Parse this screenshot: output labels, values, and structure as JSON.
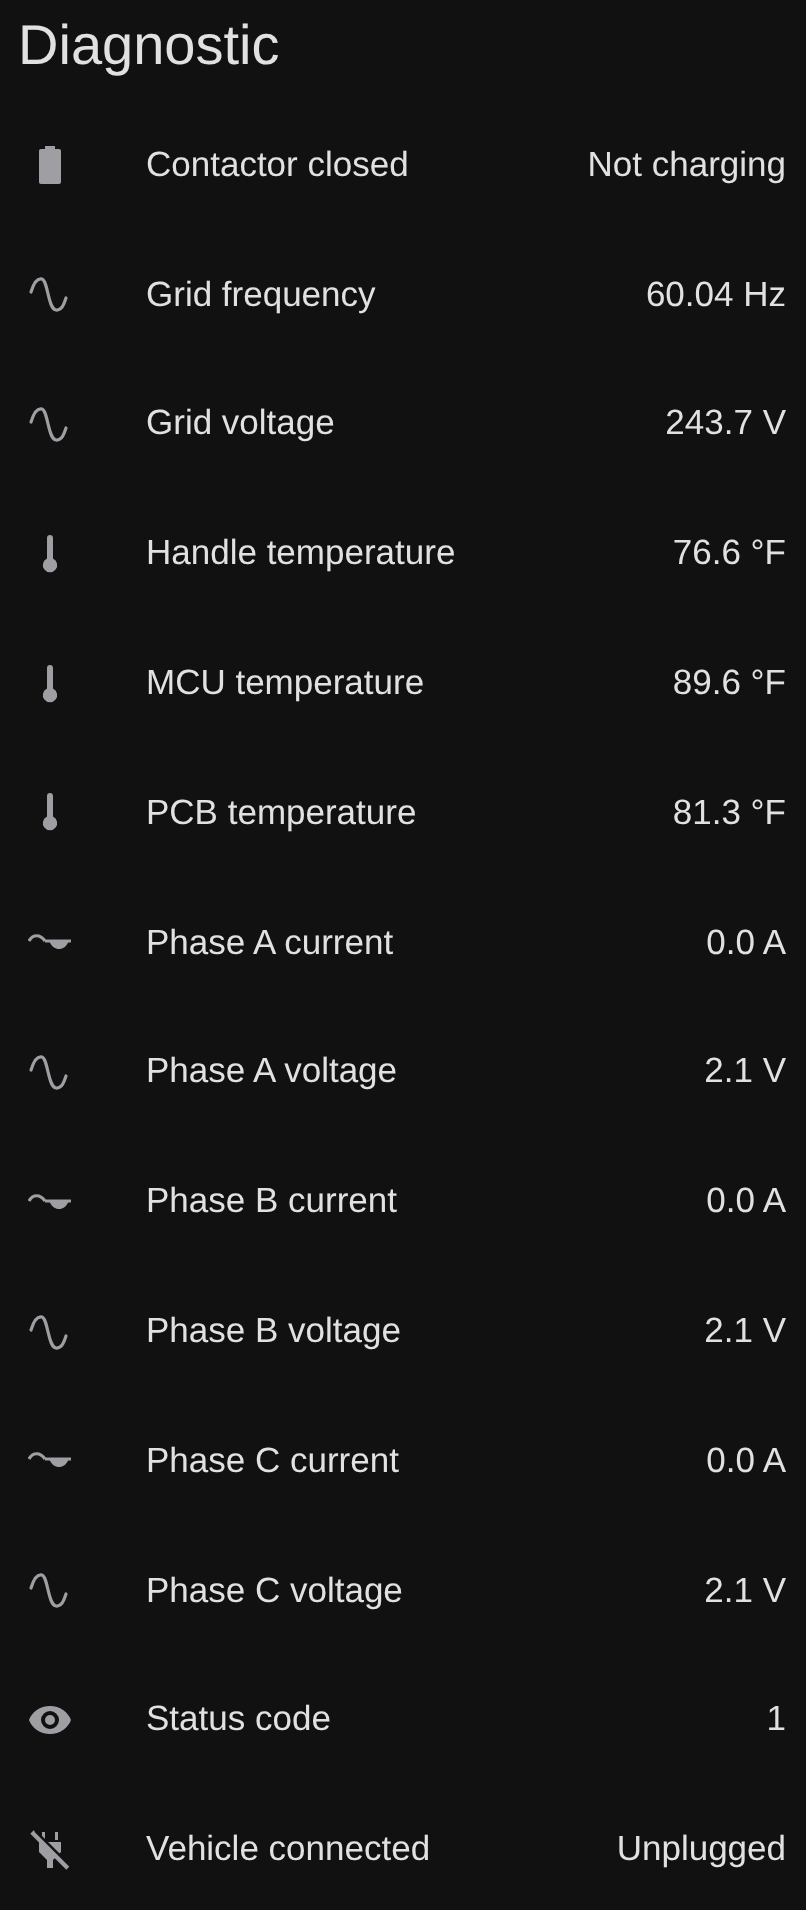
{
  "title": "Diagnostic",
  "rows": [
    {
      "kind": "battery",
      "label": "Contactor closed",
      "value": "Not charging"
    },
    {
      "kind": "sine",
      "label": "Grid frequency",
      "value": "60.04 Hz"
    },
    {
      "kind": "sine",
      "label": "Grid voltage",
      "value": "243.7 V"
    },
    {
      "kind": "thermometer",
      "label": "Handle temperature",
      "value": "76.6 °F"
    },
    {
      "kind": "thermometer",
      "label": "MCU temperature",
      "value": "89.6 °F"
    },
    {
      "kind": "thermometer",
      "label": "PCB temperature",
      "value": "81.3 °F"
    },
    {
      "kind": "current",
      "label": "Phase A current",
      "value": "0.0 A"
    },
    {
      "kind": "sine",
      "label": "Phase A voltage",
      "value": "2.1 V"
    },
    {
      "kind": "current",
      "label": "Phase B current",
      "value": "0.0 A"
    },
    {
      "kind": "sine",
      "label": "Phase B voltage",
      "value": "2.1 V"
    },
    {
      "kind": "current",
      "label": "Phase C current",
      "value": "0.0 A"
    },
    {
      "kind": "sine",
      "label": "Phase C voltage",
      "value": "2.1 V"
    },
    {
      "kind": "eye",
      "label": "Status code",
      "value": "1"
    },
    {
      "kind": "plug-off",
      "label": "Vehicle connected",
      "value": "Unplugged"
    }
  ]
}
